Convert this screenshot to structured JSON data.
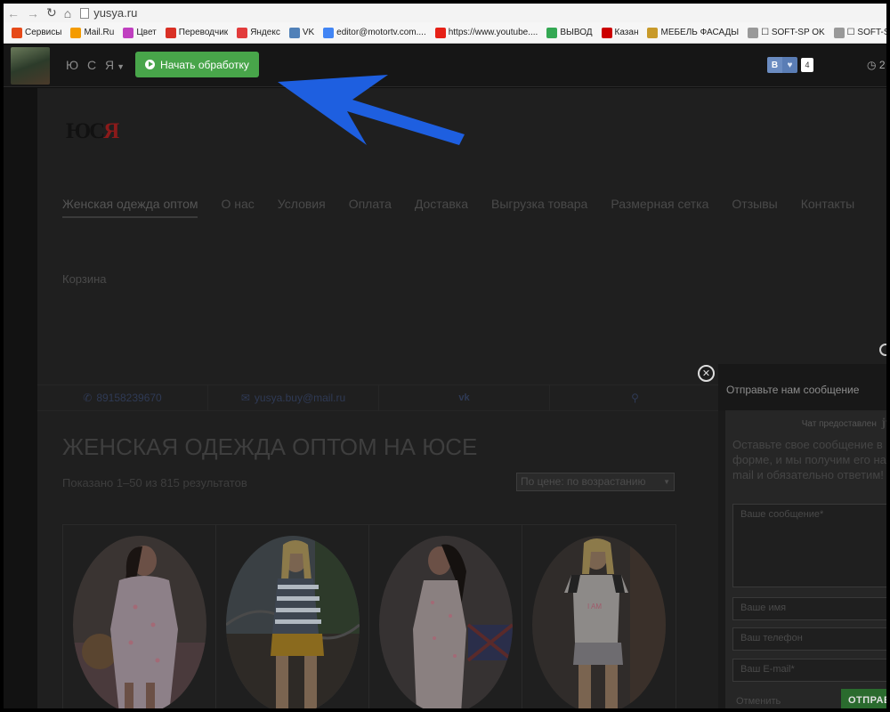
{
  "browser": {
    "url": "yusya.ru",
    "bookmarks": [
      {
        "label": "Сервисы",
        "icon": "apps-icon",
        "color": "#e64a19"
      },
      {
        "label": "Mail.Ru",
        "icon": "mailru-icon",
        "color": "#f49b00"
      },
      {
        "label": "Цвет",
        "icon": "color-wheel-icon",
        "color": "#c040c0"
      },
      {
        "label": "Переводчик",
        "icon": "translate-icon",
        "color": "#d93025"
      },
      {
        "label": "Яндекс",
        "icon": "yandex-icon",
        "color": "#e23c3c"
      },
      {
        "label": "VK",
        "icon": "vk-icon",
        "color": "#5181b8"
      },
      {
        "label": "editor@motortv.com....",
        "icon": "google-icon",
        "color": "#4285f4"
      },
      {
        "label": "https://www.youtube....",
        "icon": "youtube-icon",
        "color": "#e62117"
      },
      {
        "label": "ВЫВОД",
        "icon": "picasa-icon",
        "color": "#34a853"
      },
      {
        "label": "Казан",
        "icon": "bars-icon",
        "color": "#cc0000"
      },
      {
        "label": "МЕБЕЛЬ ФАСАДЫ",
        "icon": "triangle-logo-icon",
        "color": "#c89a2a"
      },
      {
        "label": "☐ SOFT-SP OK",
        "icon": "page-icon",
        "color": "#999999"
      },
      {
        "label": "☐ SOFT-SP BK",
        "icon": "page-icon",
        "color": "#999999"
      }
    ]
  },
  "topbar": {
    "site_name": "Ю С Я",
    "start_button": "Начать обработку",
    "vk_letter": "В",
    "vk_count": "4",
    "clock": "2"
  },
  "site": {
    "logo": {
      "a": "Ю",
      "b": "С",
      "c": "Я"
    },
    "menu": [
      "Женская одежда оптом",
      "О нас",
      "Условия",
      "Оплата",
      "Доставка",
      "Выгрузка товара",
      "Размерная сетка",
      "Отзывы",
      "Контакты"
    ],
    "cart": "Корзина",
    "phone": "89158239670",
    "email": "yusya.buy@mail.ru",
    "heading": "ЖЕНСКАЯ ОДЕЖДА ОПТОМ НА ЮСЕ",
    "result_count": "Показано 1–50 из 815 результатов",
    "sort": "По цене: по возрастанию"
  },
  "popup": {
    "title": "Отправьте нам сообщение",
    "chat_by": "Чат предоставлен",
    "description": "Оставьте свое сообщение в форме, и мы получим его на mail и обязательно ответим!",
    "message_placeholder": "Ваше сообщение*",
    "name_placeholder": "Ваше имя",
    "phone_placeholder": "Ваш телефон",
    "email_placeholder": "Ваш E-mail*",
    "cancel": "Отменить",
    "send": "ОТПРАВ"
  },
  "colors": {
    "start_button": "#48a54a",
    "vk": "#6b8cc1",
    "arrow": "#1e5fe0"
  }
}
